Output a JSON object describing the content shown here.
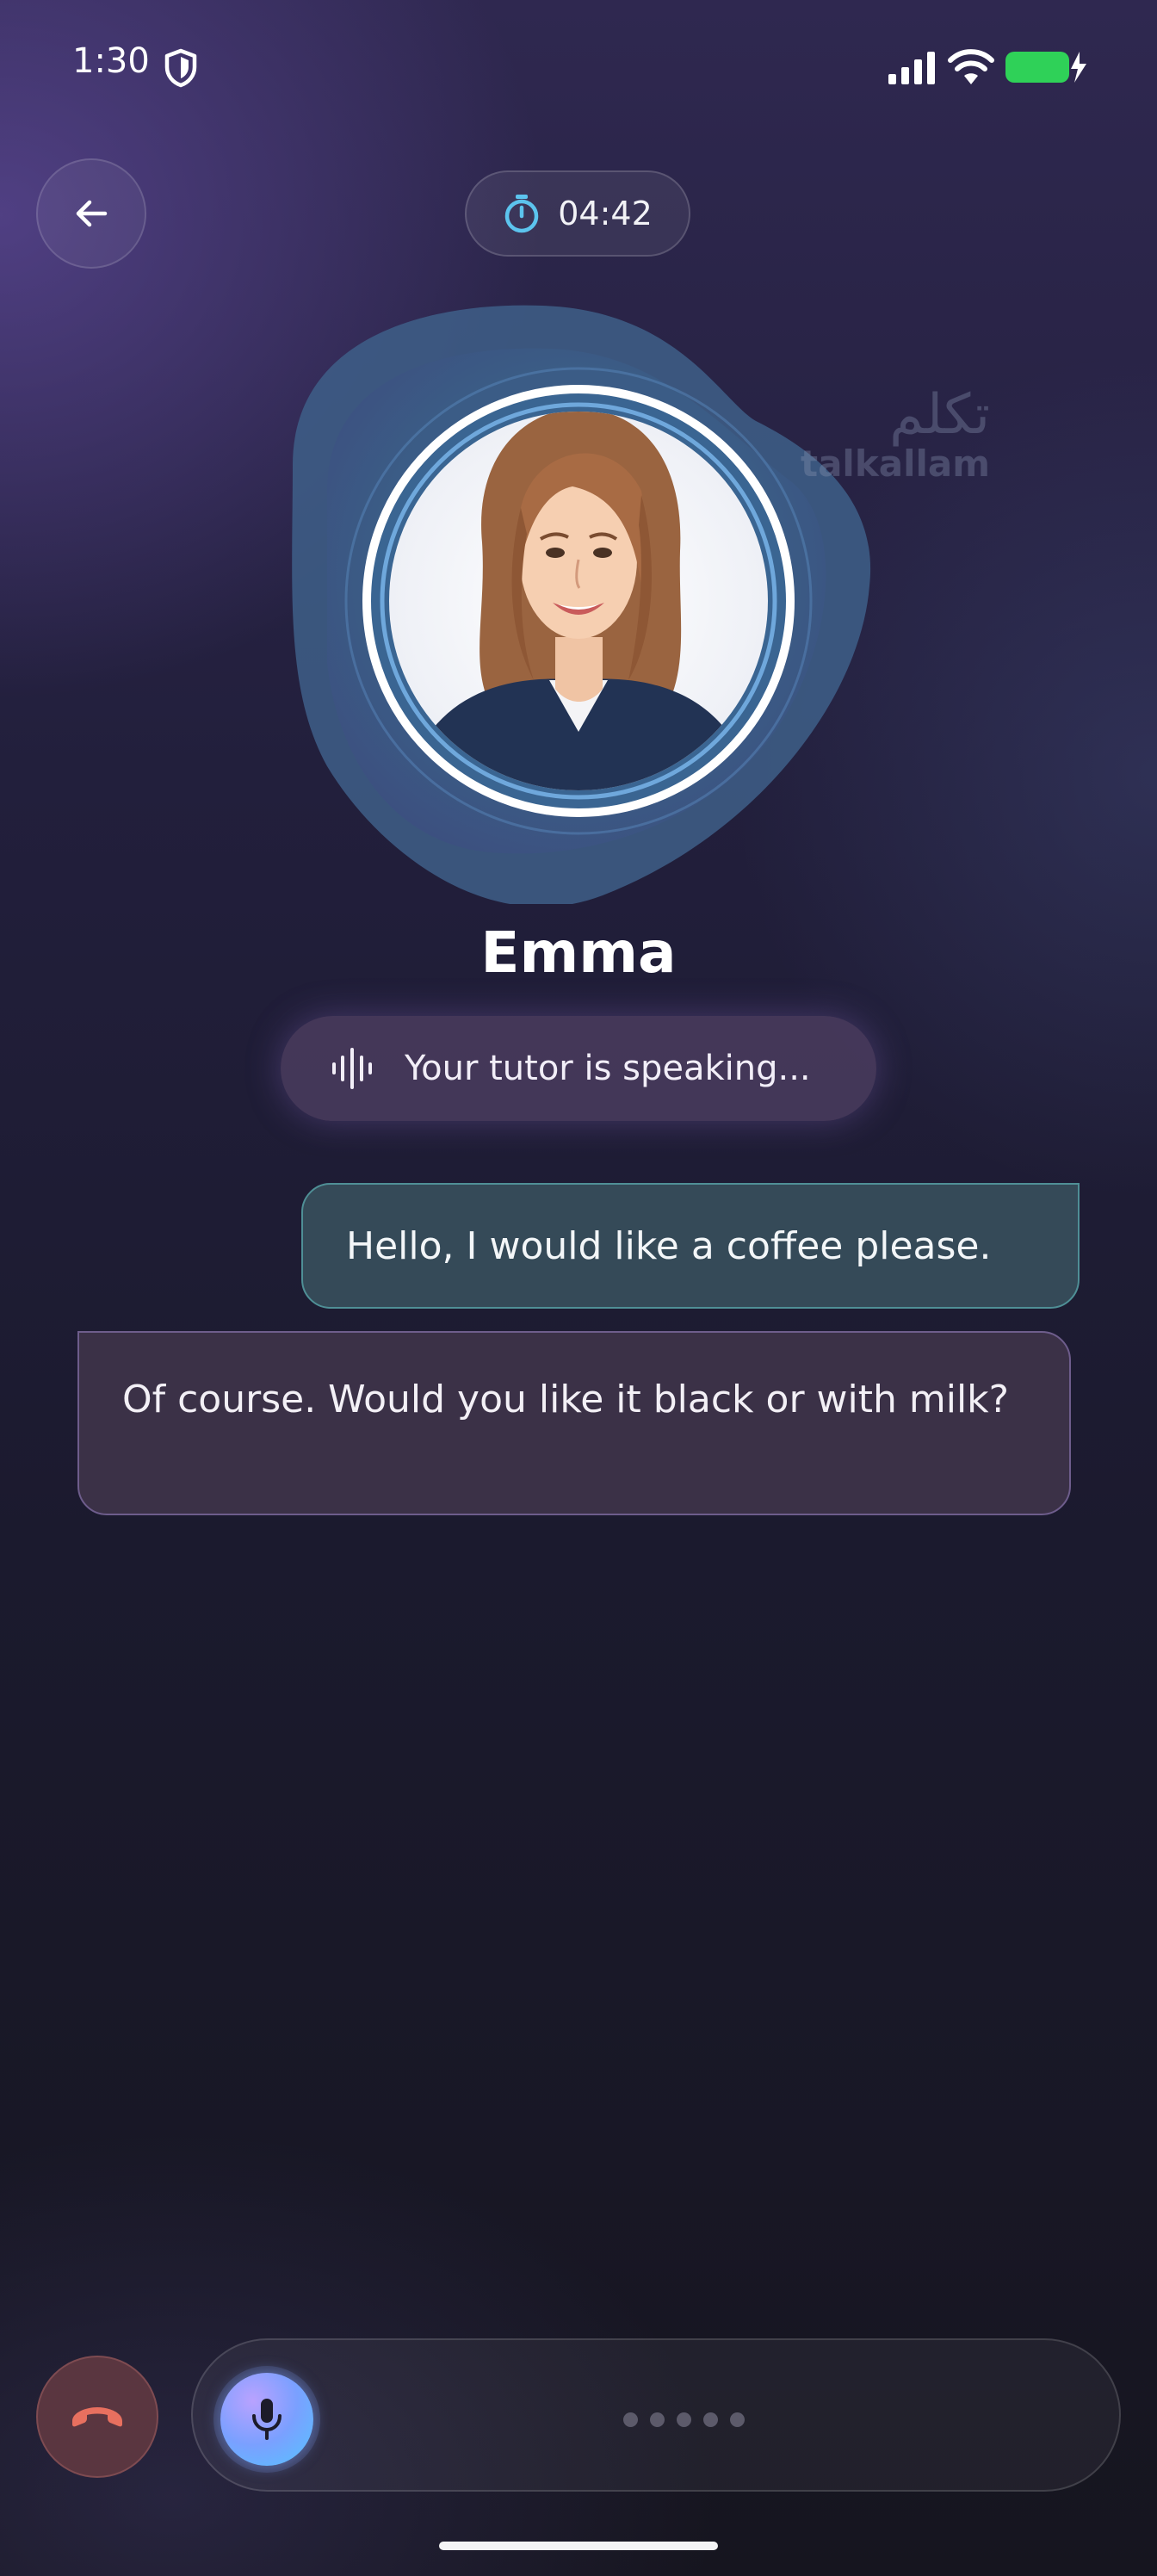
{
  "status_bar": {
    "time": "1:30"
  },
  "header": {
    "timer": "04:42"
  },
  "tutor": {
    "name": "Emma",
    "status": "Your tutor is speaking..."
  },
  "watermark": {
    "arabic": "تكلم",
    "latin": "talkallam"
  },
  "messages": [
    {
      "role": "user",
      "text": "Hello, I would like a coffee please."
    },
    {
      "role": "tutor",
      "text": "Of course. Would you like it black or with milk?"
    }
  ],
  "colors": {
    "user_bubble": "#354a58",
    "tutor_bubble": "#3b3147",
    "hangup": "#e8705f",
    "battery": "#2fd158",
    "timer_icon": "#5cc4ee"
  },
  "icons": [
    "shield-icon",
    "signal-icon",
    "wifi-icon",
    "battery-icon",
    "back-arrow-icon",
    "stopwatch-icon",
    "waveform-icon",
    "phone-hangup-icon",
    "microphone-icon"
  ]
}
